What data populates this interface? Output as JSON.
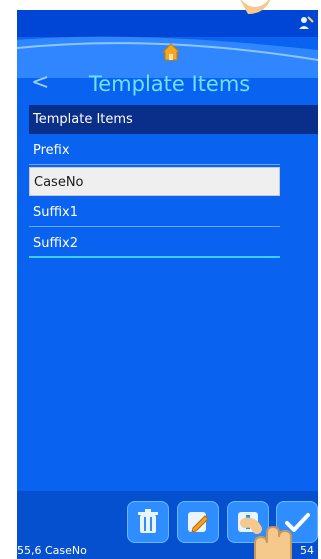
{
  "header": {
    "title": "Template Items",
    "back_label": "<"
  },
  "list": {
    "header_label": "Template Items",
    "items": [
      {
        "label": "Prefix",
        "selected": false
      },
      {
        "label": "CaseNo",
        "selected": true
      },
      {
        "label": "Suffix1",
        "selected": false
      },
      {
        "label": "Suffix2",
        "selected": false
      }
    ]
  },
  "footer": {
    "left_text": "55,6 CaseNo",
    "right_text": "54"
  },
  "icons": {
    "home": "home-icon",
    "status": "user-status-icon",
    "delete": "trash-icon",
    "edit": "edit-icon",
    "add": "add-icon",
    "confirm": "checkmark-icon"
  },
  "colors": {
    "background": "#0a62f0",
    "accent": "#6ee2ff",
    "selected": "#efefef"
  }
}
